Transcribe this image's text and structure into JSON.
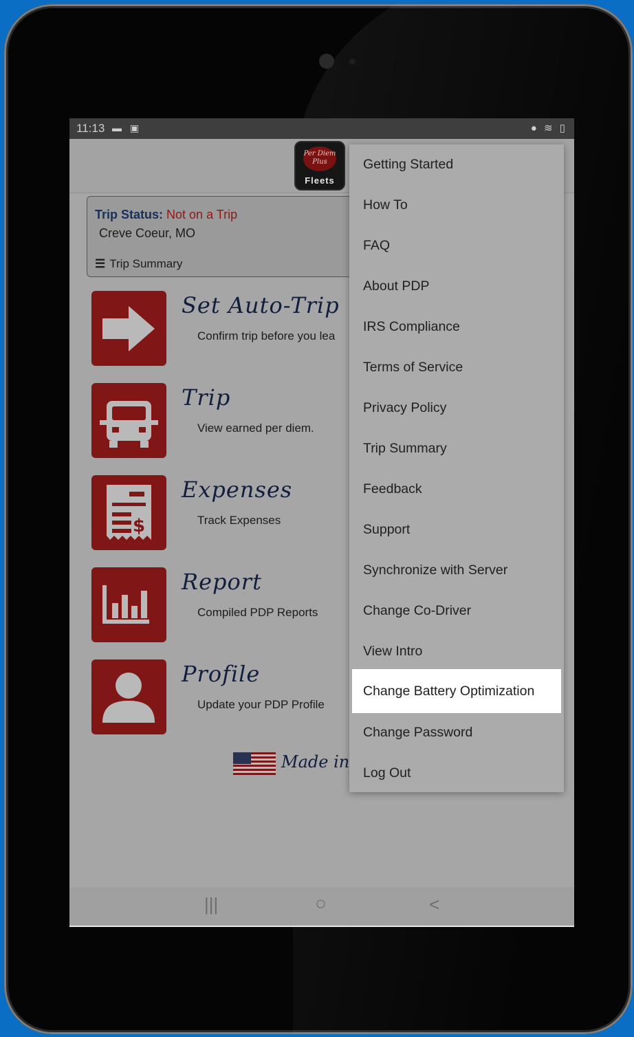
{
  "status_bar": {
    "time": "11:13",
    "left_icons": "▬ ▣",
    "right_icons": "● ≋ ▯"
  },
  "app": {
    "logo_script": "Per Diem Plus",
    "logo_label": "Fleets"
  },
  "trip_status": {
    "label": "Trip Status:",
    "value": "Not on a Trip",
    "location": "Creve Coeur, MO",
    "summary_label": "Trip Summary"
  },
  "features": [
    {
      "title": "Set Auto-Trip",
      "desc": "Confirm trip before you lea",
      "icon": "arrow-right-icon"
    },
    {
      "title": "Trip",
      "desc": "View earned per diem.",
      "icon": "truck-icon"
    },
    {
      "title": "Expenses",
      "desc": "Track Expenses",
      "icon": "receipt-icon"
    },
    {
      "title": "Report",
      "desc": "Compiled PDP Reports",
      "icon": "bar-chart-icon"
    },
    {
      "title": "Profile",
      "desc": "Update your PDP Profile",
      "icon": "person-icon"
    }
  ],
  "made_in": "Made in t",
  "menu": {
    "items": [
      "Getting Started",
      "How To",
      "FAQ",
      "About PDP",
      "IRS Compliance",
      "Terms of Service",
      "Privacy Policy",
      "Trip Summary",
      "Feedback",
      "Support",
      "Synchronize with Server",
      "Change Co-Driver",
      "View Intro",
      "Change Battery Optimization",
      "Change Password",
      "Log Out"
    ],
    "highlighted": "Change Battery Optimization"
  },
  "nav": {
    "recents": "|||",
    "home": "○",
    "back": "<"
  },
  "colors": {
    "tile_red": "#801616",
    "title_navy": "#121e3d",
    "status_red": "#8e1919",
    "backdrop_blue": "#0a6fc4"
  }
}
